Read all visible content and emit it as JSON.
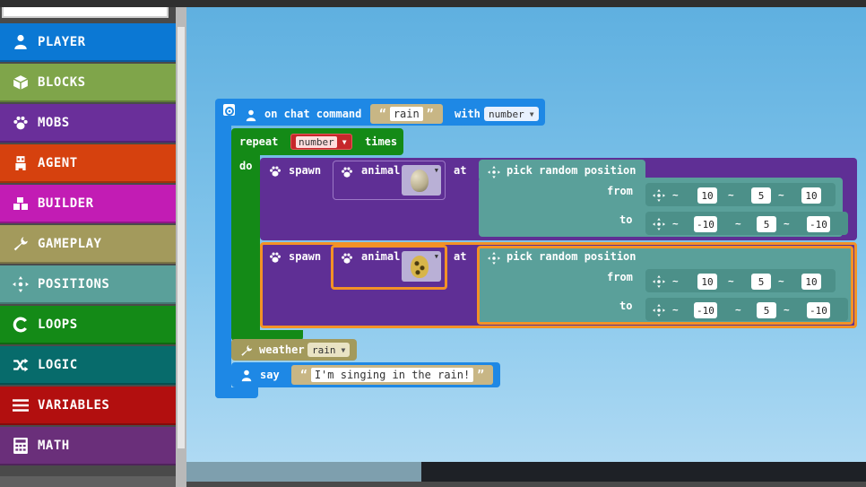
{
  "toolbox": {
    "categories": [
      {
        "label": "PLAYER",
        "icon": "person-icon",
        "color": "#0b78d4"
      },
      {
        "label": "BLOCKS",
        "icon": "cube-icon",
        "color": "#7fa54a"
      },
      {
        "label": "MOBS",
        "icon": "paw-icon",
        "color": "#6a2f9a"
      },
      {
        "label": "AGENT",
        "icon": "agent-icon",
        "color": "#d6410e"
      },
      {
        "label": "BUILDER",
        "icon": "cubes-icon",
        "color": "#c21cb4"
      },
      {
        "label": "GAMEPLAY",
        "icon": "wrench-icon",
        "color": "#a39a5c"
      },
      {
        "label": "POSITIONS",
        "icon": "crosshair-icon",
        "color": "#5aa09a"
      },
      {
        "label": "LOOPS",
        "icon": "loop-icon",
        "color": "#148a17"
      },
      {
        "label": "LOGIC",
        "icon": "shuffle-icon",
        "color": "#076b6b"
      },
      {
        "label": "VARIABLES",
        "icon": "list-icon",
        "color": "#b20f0f"
      },
      {
        "label": "MATH",
        "icon": "calculator-icon",
        "color": "#6a2f7a"
      }
    ]
  },
  "script": {
    "event": {
      "label": "on chat command",
      "command": "rain",
      "with_label": "with",
      "param": "number",
      "color": "#1e88e5"
    },
    "repeat": {
      "label": "repeat",
      "count_var": "number",
      "times_label": "times",
      "do_label": "do",
      "color": "#148a17"
    },
    "spawns": [
      {
        "spawn_label": "spawn",
        "animal_label": "animal",
        "at_label": "at",
        "position_label": "pick random position",
        "from_label": "from",
        "to_label": "to",
        "from": [
          "10",
          "5",
          "10"
        ],
        "to": [
          "-10",
          "5",
          "-10"
        ],
        "tilde": "~",
        "selected": false
      },
      {
        "spawn_label": "spawn",
        "animal_label": "animal",
        "at_label": "at",
        "position_label": "pick random position",
        "from_label": "from",
        "to_label": "to",
        "from": [
          "10",
          "5",
          "10"
        ],
        "to": [
          "-10",
          "5",
          "-10"
        ],
        "tilde": "~",
        "selected": true
      }
    ],
    "weather": {
      "label": "weather",
      "value": "rain"
    },
    "say": {
      "label": "say",
      "text": "I'm singing in the rain!"
    }
  },
  "colors": {
    "mobs": "#5f2f95",
    "positions": "#5aa09a",
    "selection": "#f39226"
  }
}
